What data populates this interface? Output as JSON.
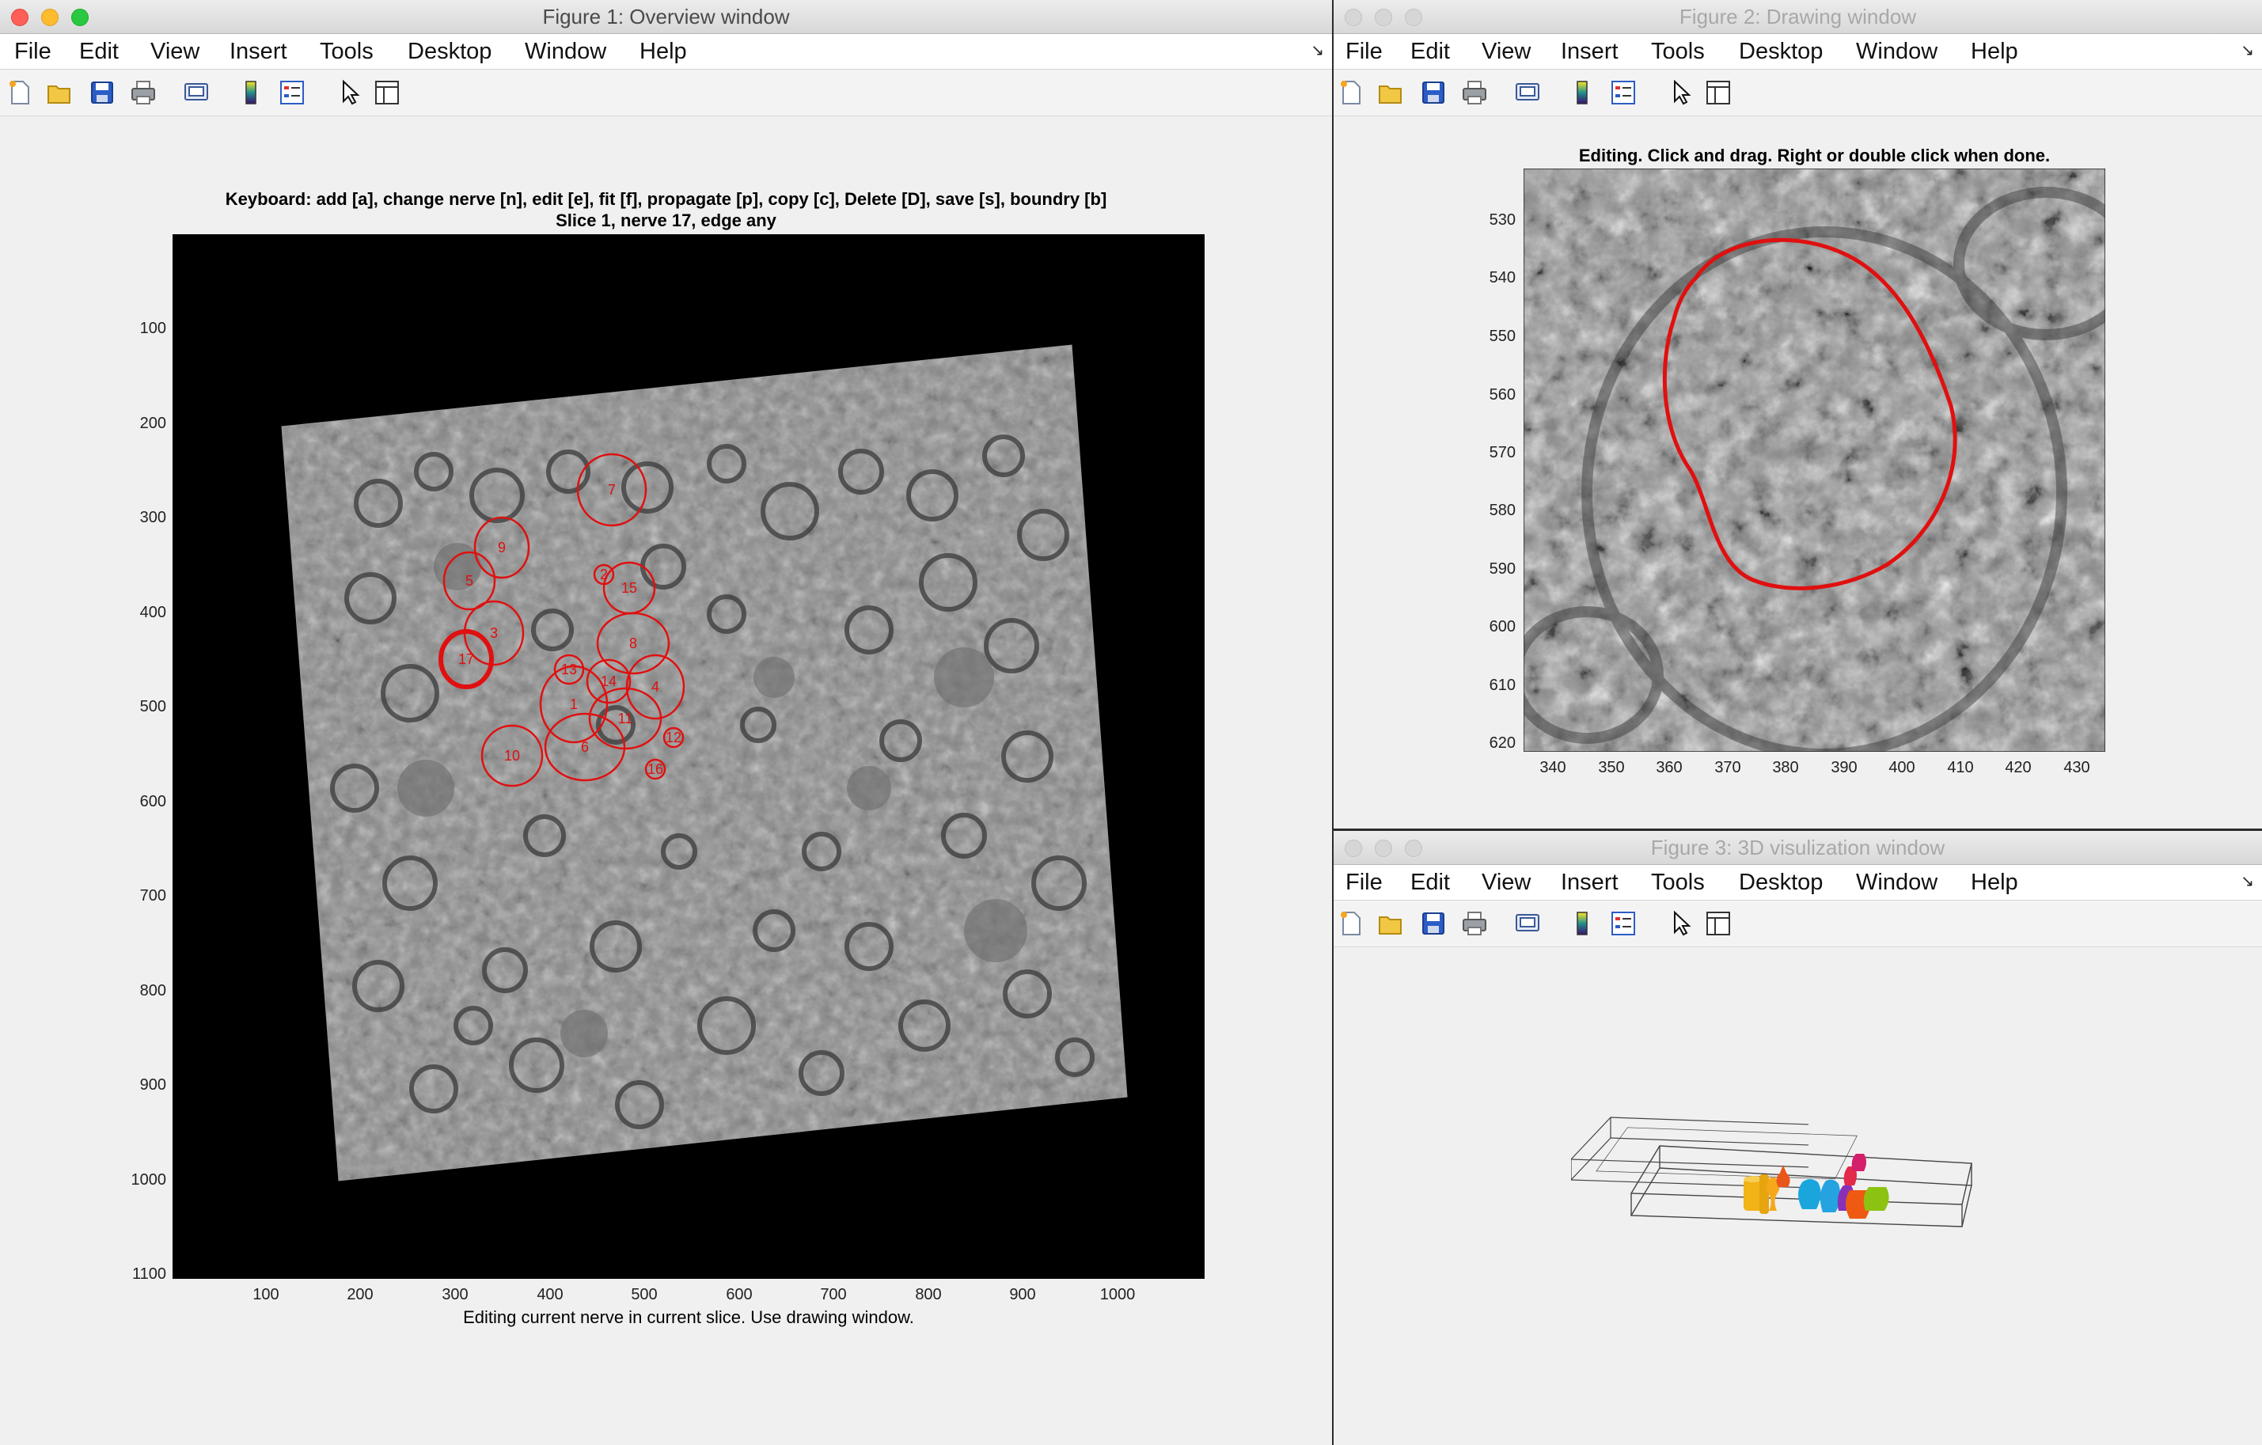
{
  "colors": {
    "close": "#fe5f57",
    "minimize": "#febb2e",
    "zoom": "#28c840",
    "contour": "#e01010"
  },
  "menus": [
    "File",
    "Edit",
    "View",
    "Insert",
    "Tools",
    "Desktop",
    "Window",
    "Help"
  ],
  "toolbar_icons": [
    "new-figure-icon",
    "open-file-icon",
    "save-icon",
    "print-icon",
    "print-preview-icon",
    "colorbar-icon",
    "legend-icon",
    "edit-plot-arrow-icon",
    "property-inspector-icon"
  ],
  "fig1": {
    "window_title": "Figure 1: Overview window",
    "axes_title_line1": "Keyboard: add [a], change nerve [n], edit [e], fit [f], propagate [p], copy [c], Delete [D], save [s], boundry [b]",
    "axes_title_line2": "Slice 1, nerve 17, edge any",
    "xlabel": "Editing current nerve in current slice. Use drawing window.",
    "yticks": [
      "100",
      "200",
      "300",
      "400",
      "500",
      "600",
      "700",
      "800",
      "900",
      "1000",
      "1100"
    ],
    "xticks": [
      "100",
      "200",
      "300",
      "400",
      "500",
      "600",
      "700",
      "800",
      "900",
      "1000"
    ],
    "nerve_labels": [
      {
        "label": "7",
        "x": 555,
        "y": 323
      },
      {
        "label": "9",
        "x": 416,
        "y": 396
      },
      {
        "label": "5",
        "x": 375,
        "y": 438
      },
      {
        "label": "2",
        "x": 545,
        "y": 430
      },
      {
        "label": "15",
        "x": 577,
        "y": 447
      },
      {
        "label": "3",
        "x": 406,
        "y": 504
      },
      {
        "label": "8",
        "x": 582,
        "y": 517
      },
      {
        "label": "17",
        "x": 371,
        "y": 537
      },
      {
        "label": "13",
        "x": 501,
        "y": 550
      },
      {
        "label": "14",
        "x": 551,
        "y": 565
      },
      {
        "label": "4",
        "x": 610,
        "y": 572
      },
      {
        "label": "1",
        "x": 507,
        "y": 594
      },
      {
        "label": "11",
        "x": 572,
        "y": 612
      },
      {
        "label": "12",
        "x": 633,
        "y": 636
      },
      {
        "label": "6",
        "x": 521,
        "y": 648
      },
      {
        "label": "10",
        "x": 429,
        "y": 659
      },
      {
        "label": "16",
        "x": 610,
        "y": 676
      }
    ]
  },
  "fig2": {
    "window_title": "Figure 2: Drawing window",
    "axes_title": "Editing. Click and drag. Right or double click when done.",
    "yticks": [
      "530",
      "540",
      "550",
      "560",
      "570",
      "580",
      "590",
      "600",
      "610",
      "620"
    ],
    "xticks": [
      "340",
      "350",
      "360",
      "370",
      "380",
      "390",
      "400",
      "410",
      "420",
      "430"
    ]
  },
  "fig3": {
    "window_title": "Figure 3: 3D visulization window"
  }
}
